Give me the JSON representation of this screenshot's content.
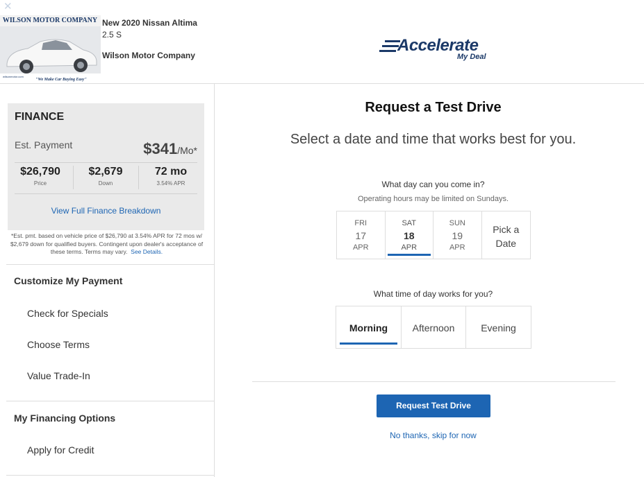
{
  "colors": {
    "accent": "#1d65b3",
    "brand": "#1b3968",
    "panel": "#eaeaea"
  },
  "header": {
    "close_icon": "close-icon",
    "car": {
      "image": "car-photo",
      "banner_text": "WILSON MOTOR COMPANY",
      "slogan": "\"We Make Car Buying Easy\"",
      "site": "wilsonmotor.com",
      "model": "New 2020 Nissan Altima",
      "trim": "2.5 S",
      "dealer": "Wilson Motor Company"
    },
    "brand": {
      "main": "Accelerate",
      "sub": "My Deal"
    }
  },
  "sidebar": {
    "finance": {
      "title": "FINANCE",
      "est_label": "Est. Payment",
      "est_value": "$341",
      "est_unit": "/Mo*",
      "stats": [
        {
          "value": "$26,790",
          "label": "Price"
        },
        {
          "value": "$2,679",
          "label": "Down"
        },
        {
          "value": "72 mo",
          "label": "3.54% APR"
        }
      ],
      "breakdown_link": "View Full Finance Breakdown"
    },
    "disclaimer": "*Est. pmt. based on vehicle price of $26,790 at 3.54% APR for 72 mos w/ $2,679 down for qualified buyers. Contingent upon dealer's acceptance of these terms. Terms may vary.",
    "see_details": "See Details.",
    "customize": {
      "heading": "Customize My Payment",
      "items": [
        "Check for Specials",
        "Choose Terms",
        "Value Trade-In"
      ]
    },
    "financing": {
      "heading": "My Financing Options",
      "items": [
        "Apply for Credit"
      ]
    }
  },
  "main": {
    "title": "Request a Test Drive",
    "subtitle": "Select a date and time that works best for you.",
    "day_question": "What day can you come in?",
    "day_note": "Operating hours may be limited on Sundays.",
    "days": [
      {
        "dow": "FRI",
        "num": "17",
        "mon": "APR"
      },
      {
        "dow": "SAT",
        "num": "18",
        "mon": "APR"
      },
      {
        "dow": "SUN",
        "num": "19",
        "mon": "APR"
      }
    ],
    "selected_day": "SAT 18 APR",
    "pick_a_date": [
      "Pick a",
      "Date"
    ],
    "time_question": "What time of day works for you?",
    "times": [
      "Morning",
      "Afternoon",
      "Evening"
    ],
    "selected_time": "Morning",
    "cta": "Request Test Drive",
    "skip": "No thanks, skip for now"
  }
}
